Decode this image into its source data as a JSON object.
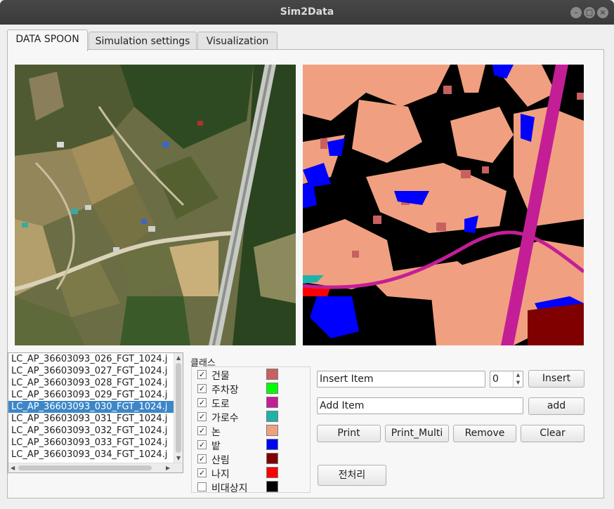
{
  "window": {
    "title": "Sim2Data",
    "btn_min": "–",
    "btn_max": "□",
    "btn_close": "×"
  },
  "tabs": [
    {
      "label": "DATA SPOON"
    },
    {
      "label": "Simulation settings"
    },
    {
      "label": "Visualization"
    }
  ],
  "file_list": [
    "LC_AP_36603093_026_FGT_1024.j",
    "LC_AP_36603093_027_FGT_1024.j",
    "LC_AP_36603093_028_FGT_1024.j",
    "LC_AP_36603093_029_FGT_1024.j",
    "LC_AP_36603093_030_FGT_1024.j",
    "LC_AP_36603093_031_FGT_1024.j",
    "LC_AP_36603093_032_FGT_1024.j",
    "LC_AP_36603093_033_FGT_1024.j",
    "LC_AP_36603093_034_FGT_1024.j"
  ],
  "selected_file_index": 4,
  "class_panel": {
    "label": "클래스",
    "classes": [
      {
        "name": "건물",
        "checked": true,
        "color": "#c86060"
      },
      {
        "name": "주차장",
        "checked": true,
        "color": "#00ff00"
      },
      {
        "name": "도로",
        "checked": true,
        "color": "#c41e96"
      },
      {
        "name": "가로수",
        "checked": true,
        "color": "#20b2aa"
      },
      {
        "name": "논",
        "checked": true,
        "color": "#f0a080"
      },
      {
        "name": "밭",
        "checked": true,
        "color": "#0000ff"
      },
      {
        "name": "산림",
        "checked": true,
        "color": "#800000"
      },
      {
        "name": "나지",
        "checked": true,
        "color": "#ff0000"
      },
      {
        "name": "비대상지",
        "checked": false,
        "color": "#000000"
      }
    ]
  },
  "controls": {
    "insert_item_value": "Insert Item",
    "spin_value": "0",
    "insert_button": "Insert",
    "add_item_value": "Add Item",
    "add_button": "add",
    "print_button": "Print",
    "print_multi_button": "Print_Multi",
    "remove_button": "Remove",
    "clear_button": "Clear",
    "preprocess_button": "전처리"
  },
  "check_mark": "✓"
}
